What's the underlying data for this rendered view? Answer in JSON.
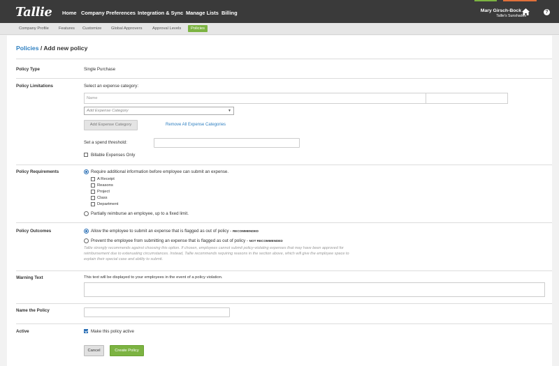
{
  "app": {
    "logo": "Tallie",
    "nav": [
      "Home",
      "Company Preferences",
      "Integration & Sync",
      "Manage Lists",
      "Billing"
    ],
    "user_name": "Mary Girsch-Bock",
    "user_caret": "⌄",
    "company_name": "Tallie's Sunshades",
    "help_glyph": "?"
  },
  "subnav": [
    "Company Profile",
    "Features",
    "Customize",
    "Global Approvers",
    "Approval Levels",
    "Policies"
  ],
  "page": {
    "breadcrumb_link": "Policies",
    "breadcrumb_rest": " / Add new policy"
  },
  "policy_type": {
    "label": "Policy Type",
    "value": "Single Purchase"
  },
  "limitations": {
    "label": "Policy Limitations",
    "intro": "Select an expense category:",
    "table_header_name": "Name",
    "select_placeholder": "Add Expense Category",
    "add_button": "Add Expense Category",
    "remove_link": "Remove All Expense Categories",
    "threshold_label": "Set a spend threshold:",
    "threshold_value": "",
    "billable_label": "Billable Expenses Only"
  },
  "requirements": {
    "label": "Policy Requirements",
    "option_1": "Require additional information before employee can submit an expense.",
    "items": [
      "A Receipt",
      "Reasons",
      "Project",
      "Class",
      "Department"
    ],
    "option_2": "Partially reimburse an employee, up to a fixed limit."
  },
  "outcomes": {
    "label": "Policy Outcomes",
    "option_1": "Allow the employee to submit an expense that is flagged as out of policy - ",
    "option_1_badge": "RECOMMENDED",
    "option_2": "Prevent the employee from submitting an expense that is flagged as out of policy - ",
    "option_2_badge": "NOT RECOMMENDED",
    "hint": "Tallie strongly recommends against choosing this option. If chosen, employees cannot submit policy-violating expenses that may have been approved for reimbursement due to extenuating circumstances. Instead, Tallie recommends requiring reasons in the section above, which will give the employee space to explain their special case and ability to submit."
  },
  "warning": {
    "label": "Warning Text",
    "description": "This text will be displayed to your employees in the event of a policy violation.",
    "value": ""
  },
  "name_policy": {
    "label": "Name the Policy",
    "value": ""
  },
  "active": {
    "label": "Active",
    "checkbox_label": "Make this policy active",
    "checked": true
  },
  "actions": {
    "cancel": "Cancel",
    "create": "Create Policy"
  },
  "colors": {
    "topbar": "#3a3a3a",
    "accent_green": "#7cb342",
    "link_blue": "#2d7fc1",
    "accent_orange": "#e0703a"
  }
}
